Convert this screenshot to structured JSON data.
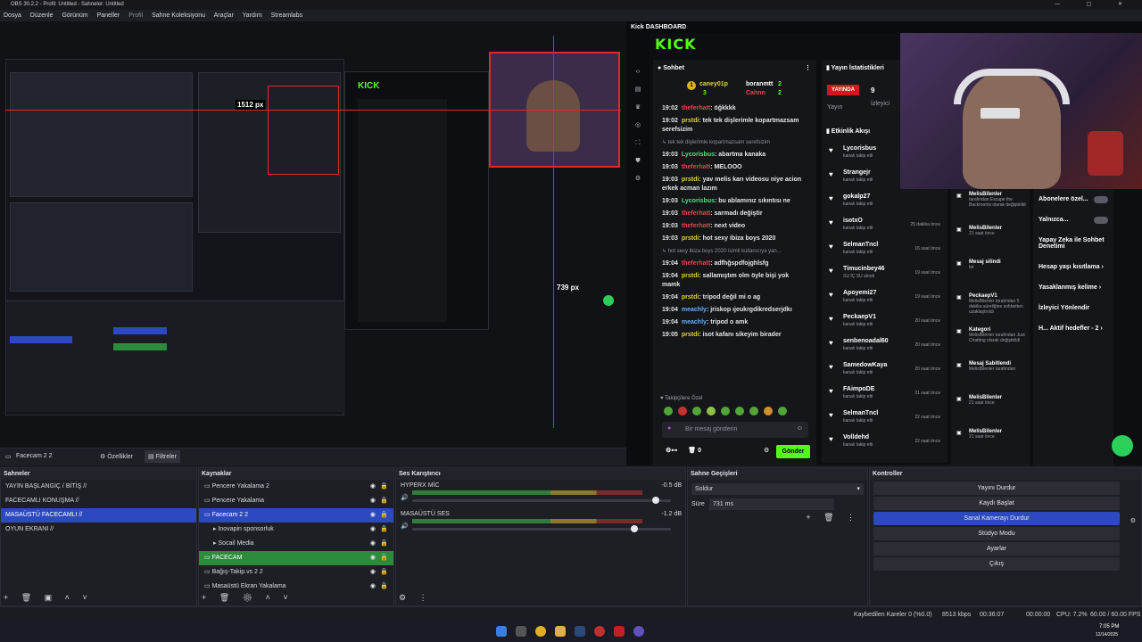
{
  "window": {
    "title": "OBS 30.2.2 - Profil: Untitled - Sahneler: Untitled"
  },
  "menu": [
    "Dosya",
    "Düzenle",
    "Görünüm",
    "Paneller",
    "Profil",
    "Sahne Koleksiyonu",
    "Araçlar",
    "Yardım",
    "Streamlabs"
  ],
  "kick": {
    "dock_title": "Kick DASHBOARD",
    "logo": "KICK",
    "chat_title": "Sohbet",
    "stats_title": "Yayın İstatistikleri",
    "live_badge": "YAYINDA",
    "viewers_value": "9",
    "stream_label": "Yayın",
    "viewers_label": "İzleyici",
    "events_title": "Etkinlik Akışı",
    "leaders": [
      {
        "name": "caney01p",
        "count": "3"
      },
      {
        "name": "boranmtt",
        "count": "2"
      },
      {
        "name": "Cahnn",
        "count": "2"
      }
    ],
    "messages": [
      {
        "time": "19:02",
        "user": "theferhatt",
        "cls": "u-r",
        "text": "öğkkkk"
      },
      {
        "time": "19:02",
        "user": "prstdi",
        "cls": "u-y",
        "text": "tek tek dişlerimle kopartmazsam serefsizim"
      },
      {
        "note": "↳ tek tek dişlerimle kopartmazsam serefsizim"
      },
      {
        "time": "19:03",
        "user": "Lycorisbus",
        "cls": "u-g",
        "text": "abartma kanaka"
      },
      {
        "time": "19:03",
        "user": "theferhatt",
        "cls": "u-r",
        "text": "MELOOO"
      },
      {
        "time": "19:03",
        "user": "prstdi",
        "cls": "u-y",
        "text": "yav melis karı videosu niye acion erkek acman lazım"
      },
      {
        "time": "19:03",
        "user": "Lycorisbus",
        "cls": "u-g",
        "text": "bu ablamınız sıkıntısı ne"
      },
      {
        "time": "19:03",
        "user": "theferhatt",
        "cls": "u-r",
        "text": "sarmadı değiştir"
      },
      {
        "time": "19:03",
        "user": "theferhatt",
        "cls": "u-r",
        "text": "next video"
      },
      {
        "time": "19:03",
        "user": "prstdi",
        "cls": "u-y",
        "text": "hot sexy ibiza boys 2020"
      },
      {
        "note": "↳ hot sexy ibiza boys 2020 isimli kullanıcıya yan..."
      },
      {
        "time": "19:04",
        "user": "theferhatt",
        "cls": "u-r",
        "text": "adfhğspdfojghlsfg"
      },
      {
        "time": "19:04",
        "user": "prstdi",
        "cls": "u-y",
        "text": "sallamıştım olm öyle bişi yok mamk"
      },
      {
        "time": "19:04",
        "user": "prstdi",
        "cls": "u-y",
        "text": "tripod değil mi o ag"
      },
      {
        "time": "19:04",
        "user": "meachly",
        "cls": "u-b",
        "text": "jriskop ıjeukrgdikredserjdkı"
      },
      {
        "time": "19:04",
        "user": "meachly",
        "cls": "u-b",
        "text": "tripod o amk"
      },
      {
        "time": "19:05",
        "user": "prstdi",
        "cls": "u-y",
        "text": "isot kafanı sikeyim birader"
      }
    ],
    "followers_label": "Takipçilere Özel",
    "input_placeholder": "Bir mesaj gönderin",
    "send_button": "Gönder",
    "bottom_count": "0",
    "events": [
      {
        "name": "Lycorisbus",
        "sub": "kanalı takip etti",
        "ago": ""
      },
      {
        "name": "Strangejr",
        "sub": "kanalı takip etti",
        "ago": ""
      },
      {
        "name": "gokalp27",
        "sub": "kanalı takip etti",
        "ago": ""
      },
      {
        "name": "isotxO",
        "sub": "kanalı takip etti",
        "ago": "25 dakika önce"
      },
      {
        "name": "SelmanTncl",
        "sub": "kanalı takip etti",
        "ago": "16 saat önce"
      },
      {
        "name": "Timucinbey46",
        "sub": "SU İÇ SU alındı",
        "ago": "19 saat önce"
      },
      {
        "name": "Apoyemi27",
        "sub": "kanalı takip etti",
        "ago": "19 saat önce"
      },
      {
        "name": "PeckaepV1",
        "sub": "kanalı takip etti",
        "ago": "20 saat önce"
      },
      {
        "name": "senbenoadal60",
        "sub": "kanalı takip etti",
        "ago": "20 saat önce"
      },
      {
        "name": "SamedowKaya",
        "sub": "kanalı takip etti",
        "ago": "20 saat önce"
      },
      {
        "name": "FAimpoDE",
        "sub": "kanalı takip etti",
        "ago": "21 saat önce"
      },
      {
        "name": "SelmanTncl",
        "sub": "kanalı takip etti",
        "ago": "22 saat önce"
      },
      {
        "name": "Volldehd",
        "sub": "kanalı takip etti",
        "ago": "22 saat önce"
      }
    ],
    "feed2": [
      {
        "title": "MelisBilenler",
        "sub": "tarafından Escape the Backrooms olarak değiştirildi"
      },
      {
        "title": "MelisBilenler",
        "sub": "21 saat önce"
      },
      {
        "title": "Mesaj silindi",
        "sub": "bir"
      },
      {
        "title": "PeckaepV1",
        "sub": "MelisBilenler tarafından 5 dakika süreliğine sohbetten uzaklaştırıldı"
      },
      {
        "title": "Kategori",
        "sub": "MelisBilenler tarafından Just Chatting olarak değiştirildi"
      },
      {
        "title": "Mesaj Sabitlendi",
        "sub": "MelisBilenler tarafından"
      },
      {
        "title": "MelisBilenler",
        "sub": "21 saat önce"
      },
      {
        "title": "MelisBilenler",
        "sub": "21 saat önce"
      }
    ],
    "settings": [
      {
        "label": "Abonelere özel..."
      },
      {
        "label": "Yalnızca..."
      },
      {
        "label": "Yapay Zeka ile Sohbet Denetimi"
      },
      {
        "label": "Hesap yaşı kısıtlama"
      },
      {
        "label": "Yasaklanmış kelime"
      },
      {
        "label": "İzleyici Yönlendir"
      },
      {
        "label": "H... Aktif hedefler - 2"
      }
    ]
  },
  "preview_overlay": {
    "px1": "1512 px",
    "px2": "739 px"
  },
  "subbar": {
    "source_name": "Facecam 2 2",
    "properties": "Özellikler",
    "filters": "Filtreler"
  },
  "scenes": {
    "title": "Sahneler",
    "items": [
      "YAYIN BAŞLANGIÇ / BİTİŞ //",
      "FACECAMLI KONUŞMA //",
      "MASAÜSTÜ FACECAMLI //",
      "OYUN EKRANI //"
    ],
    "selected": 2
  },
  "sources": {
    "title": "Kaynaklar",
    "items": [
      {
        "label": "Pencere Yakalama 2",
        "indent": 0,
        "state": ""
      },
      {
        "label": "Pencere Yakalama",
        "indent": 0,
        "state": ""
      },
      {
        "label": "Facecam 2 2",
        "indent": 0,
        "state": "sel"
      },
      {
        "label": "Inovapin sponsorluk",
        "indent": 1,
        "state": ""
      },
      {
        "label": "Socail Media",
        "indent": 1,
        "state": ""
      },
      {
        "label": "FACECAM",
        "indent": 0,
        "state": "grn"
      },
      {
        "label": "Bağış-Takip.vs 2 2",
        "indent": 0,
        "state": ""
      },
      {
        "label": "Masaüstü Ekran Yakalama",
        "indent": 0,
        "state": ""
      }
    ]
  },
  "mixer": {
    "title": "Ses Karıştırıcı",
    "channels": [
      {
        "name": "HYPERX MİC",
        "db": "-0.5 dB",
        "level": 0.94
      },
      {
        "name": "MASAÜSTÜ SES",
        "db": "-1.2 dB",
        "level": 0.86
      }
    ],
    "ticks": [
      "-60",
      "-55",
      "-50",
      "-45",
      "-40",
      "-35",
      "-30",
      "-25",
      "-20",
      "-15",
      "-10",
      "-5",
      "0"
    ]
  },
  "transitions": {
    "title": "Sahne Geçişleri",
    "type": "Soldur",
    "duration_label": "Süre",
    "duration_value": "731 ms"
  },
  "controls": {
    "title": "Kontroller",
    "buttons": [
      "Yayını Durdur",
      "Kaydı Başlat",
      "Sanal Kamerayı Durdur",
      "Stüdyo Modu",
      "Ayarlar",
      "Çıkış"
    ],
    "active": 2
  },
  "status": {
    "dropped": "Kaybedilen Kareler 0 (%0.0)",
    "kbps": "8513 kbps",
    "stream_time": "00:36:07",
    "rec_time": "00:00:00",
    "cpu": "CPU: 7.2%",
    "fps": "60.00 / 60.00 FPS"
  },
  "taskbar": {
    "time": "7:05 PM",
    "date": "12/14/2025"
  }
}
